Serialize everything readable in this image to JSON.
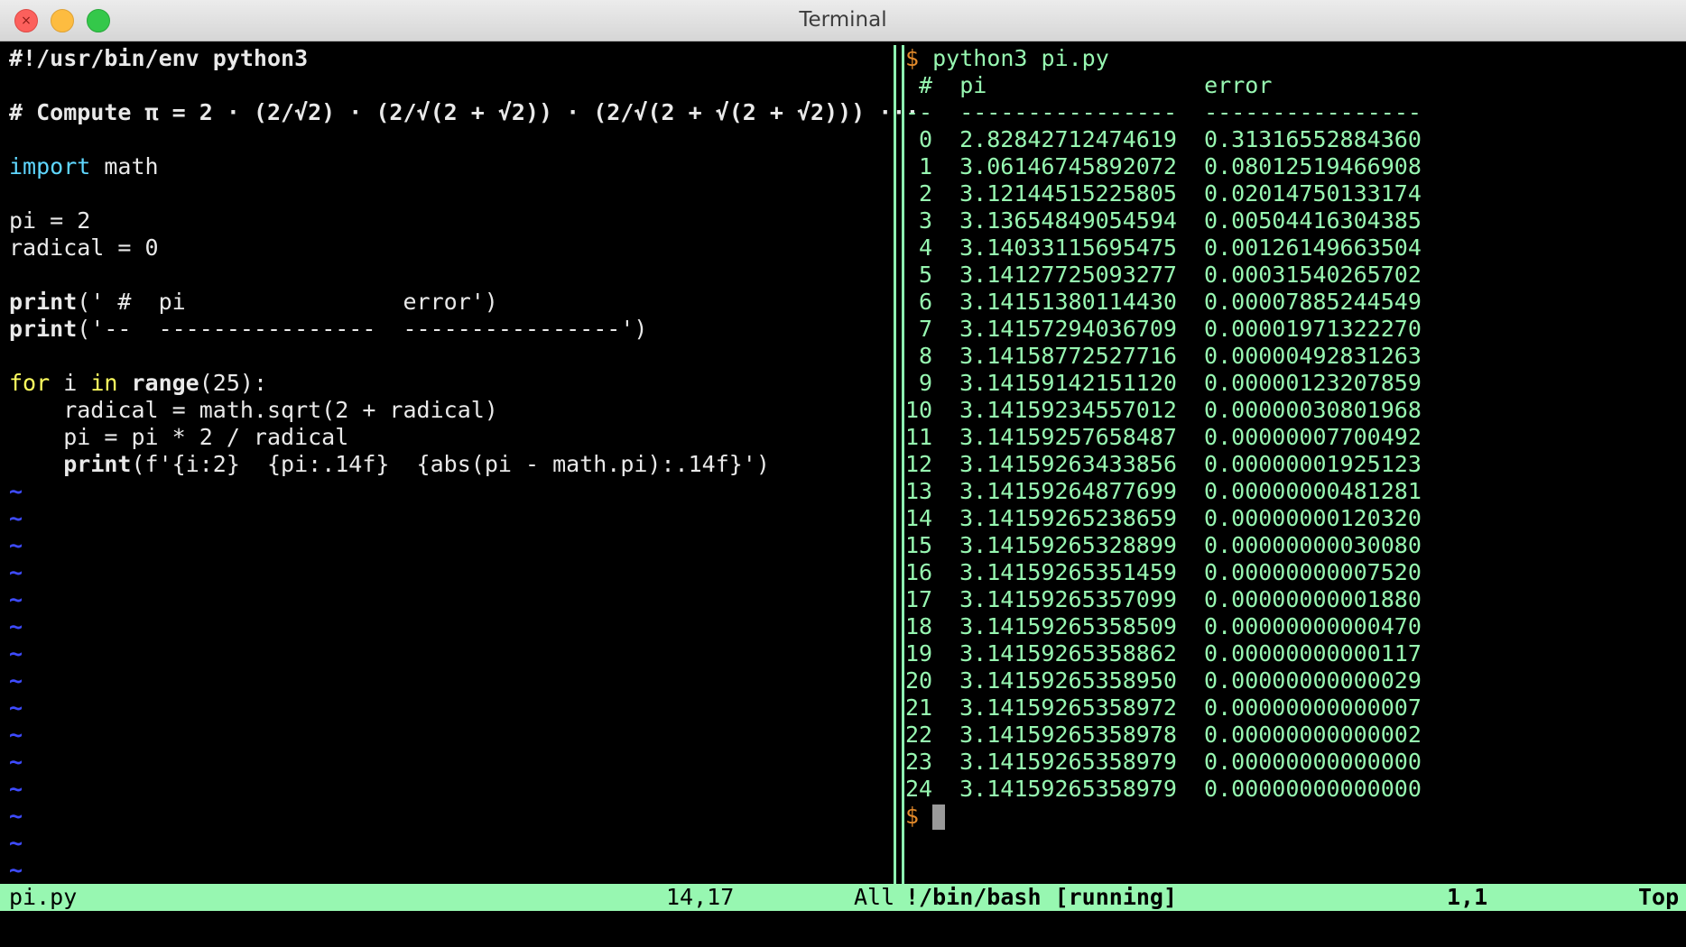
{
  "window": {
    "title": "Terminal"
  },
  "editor": {
    "lines": [
      "#!/usr/bin/env python3",
      "",
      "# Compute π = 2 · (2/√2) · (2/√(2 + √2)) · (2/√(2 + √(2 + √2))) ···",
      "",
      "",
      "",
      "pi = 2",
      "radical = 0",
      "",
      "",
      "",
      "",
      "",
      "    radical = math.sqrt(2 + radical)",
      "    pi = pi * 2 / radical",
      ""
    ],
    "import_kw": "import",
    "import_rest": " math",
    "print1_kw": "print",
    "print1_rest": "(' #  pi                error')",
    "print2_kw": "print",
    "print2_rest": "('--  ----------------  ----------------')",
    "for_kw": "for",
    "for_mid1": " i ",
    "in_kw": "in",
    "range_kw": " range",
    "for_rest": "(25):",
    "print3_indent": "    ",
    "print3_kw": "print",
    "print3_rest": "(f'{i:2}  {pi:.14f}  {abs(pi - math.pi):.14f}')",
    "tilde": "~",
    "tilde_count": 15
  },
  "shell": {
    "prompt": "$",
    "command": " python3 pi.py",
    "header": " #  pi                error",
    "rule": "--  ----------------  ----------------",
    "rows": [
      {
        "i": "0",
        "pi": "2.82842712474619",
        "err": "0.31316552884360"
      },
      {
        "i": "1",
        "pi": "3.06146745892072",
        "err": "0.08012519466908"
      },
      {
        "i": "2",
        "pi": "3.12144515225805",
        "err": "0.02014750133174"
      },
      {
        "i": "3",
        "pi": "3.13654849054594",
        "err": "0.00504416304385"
      },
      {
        "i": "4",
        "pi": "3.14033115695475",
        "err": "0.00126149663504"
      },
      {
        "i": "5",
        "pi": "3.14127725093277",
        "err": "0.00031540265702"
      },
      {
        "i": "6",
        "pi": "3.14151380114430",
        "err": "0.00007885244549"
      },
      {
        "i": "7",
        "pi": "3.14157294036709",
        "err": "0.00001971322270"
      },
      {
        "i": "8",
        "pi": "3.14158772527716",
        "err": "0.00000492831263"
      },
      {
        "i": "9",
        "pi": "3.14159142151120",
        "err": "0.00000123207859"
      },
      {
        "i": "10",
        "pi": "3.14159234557012",
        "err": "0.00000030801968"
      },
      {
        "i": "11",
        "pi": "3.14159257658487",
        "err": "0.00000007700492"
      },
      {
        "i": "12",
        "pi": "3.14159263433856",
        "err": "0.00000001925123"
      },
      {
        "i": "13",
        "pi": "3.14159264877699",
        "err": "0.00000000481281"
      },
      {
        "i": "14",
        "pi": "3.14159265238659",
        "err": "0.00000000120320"
      },
      {
        "i": "15",
        "pi": "3.14159265328899",
        "err": "0.00000000030080"
      },
      {
        "i": "16",
        "pi": "3.14159265351459",
        "err": "0.00000000007520"
      },
      {
        "i": "17",
        "pi": "3.14159265357099",
        "err": "0.00000000001880"
      },
      {
        "i": "18",
        "pi": "3.14159265358509",
        "err": "0.00000000000470"
      },
      {
        "i": "19",
        "pi": "3.14159265358862",
        "err": "0.00000000000117"
      },
      {
        "i": "20",
        "pi": "3.14159265358950",
        "err": "0.00000000000029"
      },
      {
        "i": "21",
        "pi": "3.14159265358972",
        "err": "0.00000000000007"
      },
      {
        "i": "22",
        "pi": "3.14159265358978",
        "err": "0.00000000000002"
      },
      {
        "i": "23",
        "pi": "3.14159265358979",
        "err": "0.00000000000000"
      },
      {
        "i": "24",
        "pi": "3.14159265358979",
        "err": "0.00000000000000"
      }
    ]
  },
  "status": {
    "left_file": "pi.py",
    "left_pos": "14,17",
    "left_scroll": "All",
    "right_name": "!/bin/bash [running]",
    "right_pos": "1,1",
    "right_scroll": "Top"
  },
  "colors": {
    "background": "#000000",
    "text": "#e9e9e9",
    "keyword_cyan": "#5fd7ff",
    "keyword_yellow": "#ffff5f",
    "output_green": "#97f7b1",
    "tilde_blue": "#3e4bff",
    "prompt_orange": "#e38a2a"
  }
}
